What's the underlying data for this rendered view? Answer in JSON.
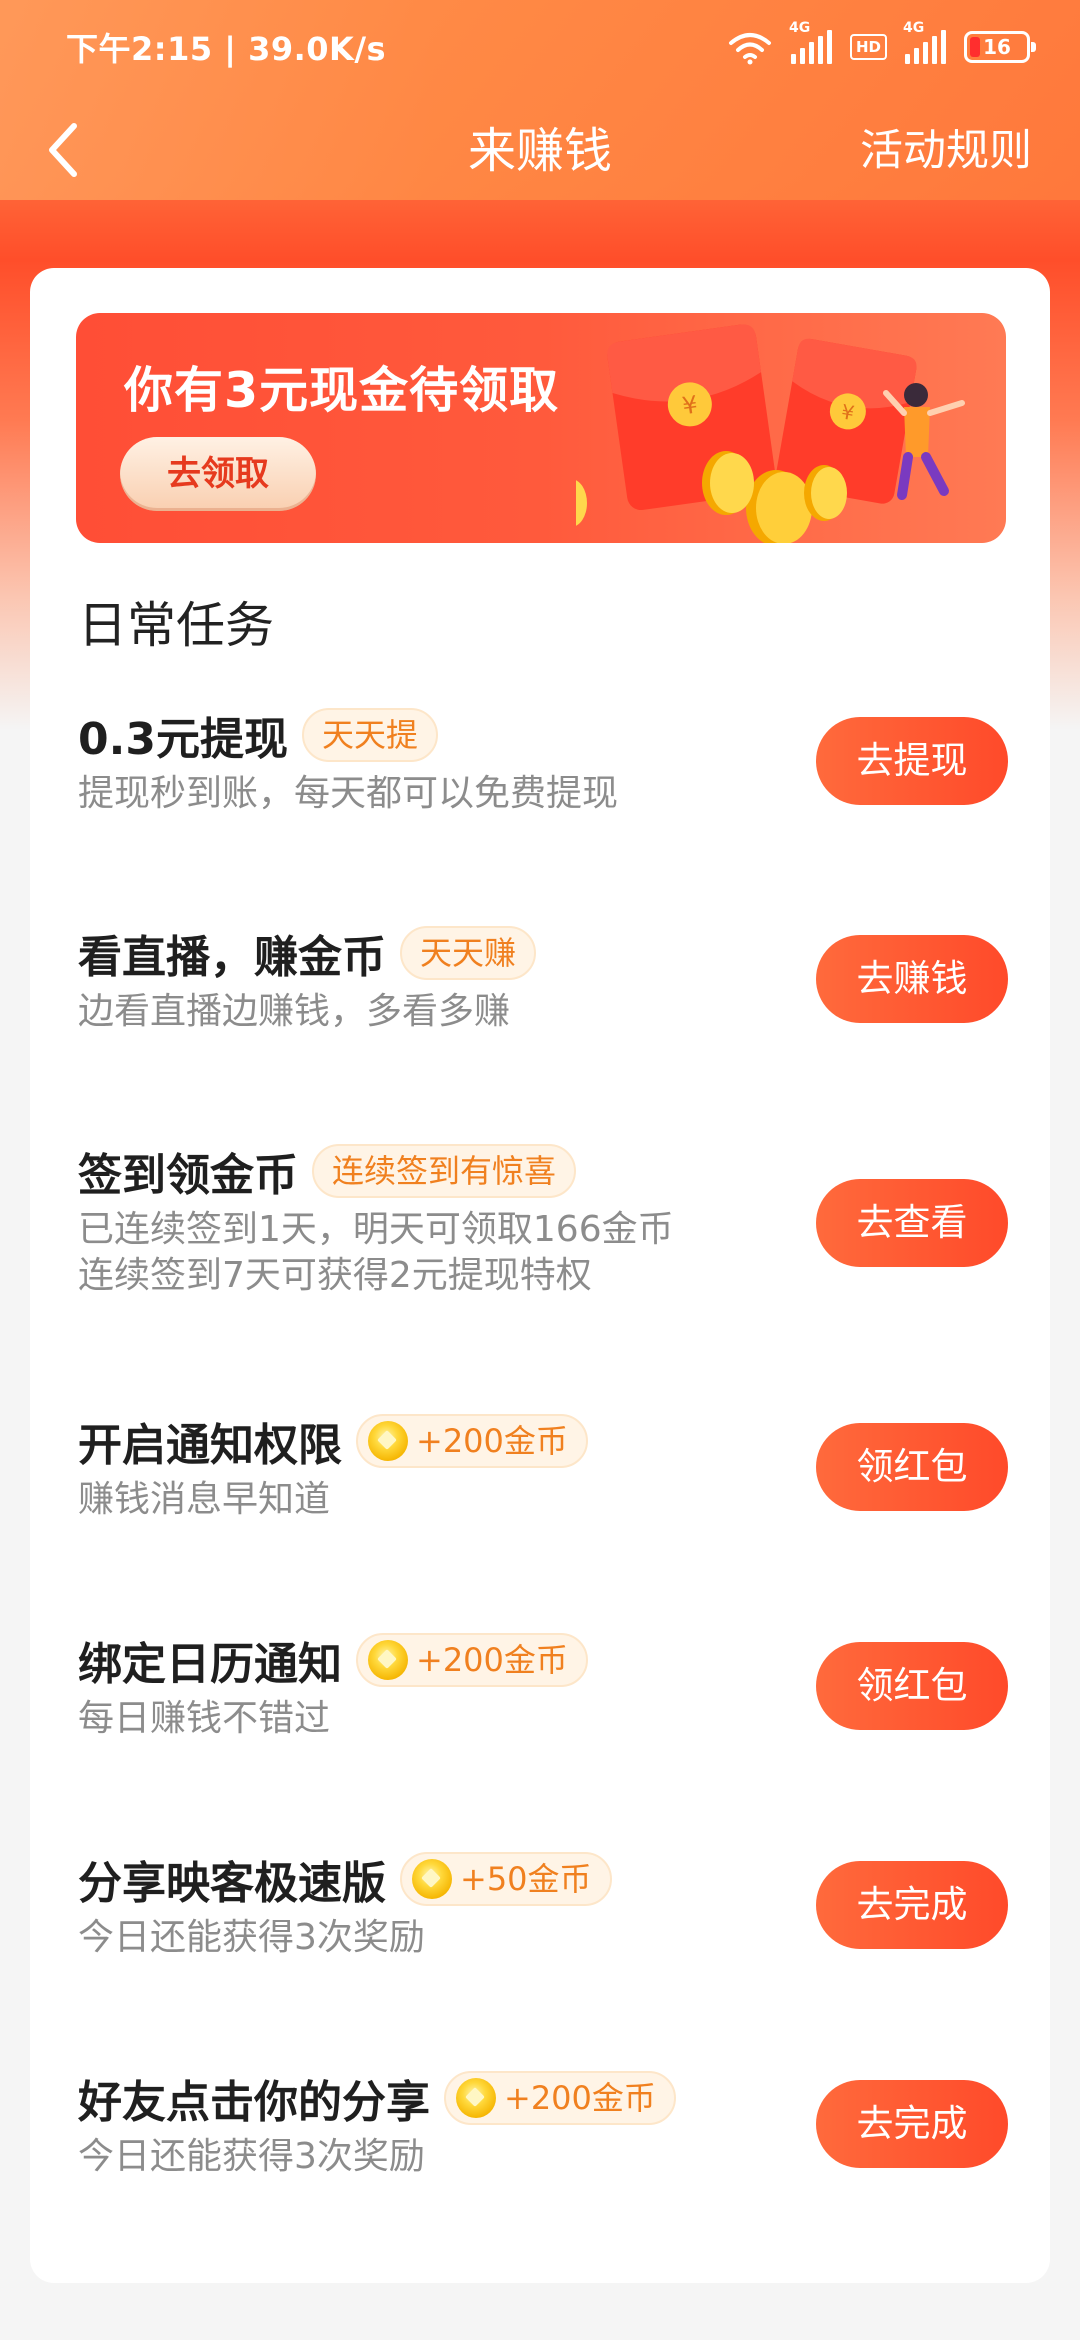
{
  "status_bar": {
    "time": "下午2:15 | 39.0K/s",
    "net1": "4G",
    "hd": "HD",
    "net2": "4G",
    "battery": "16"
  },
  "nav": {
    "title": "来赚钱",
    "rules": "活动规则"
  },
  "banner": {
    "title": "你有3元现金待领取",
    "button": "去领取"
  },
  "section_title": "日常任务",
  "tasks": [
    {
      "title": "0.3元提现",
      "badge": "天天提",
      "desc": "提现秒到账，每天都可以免费提现",
      "button": "去提现"
    },
    {
      "title": "看直播，赚金币",
      "badge": "天天赚",
      "desc": "边看直播边赚钱，多看多赚",
      "button": "去赚钱"
    },
    {
      "title": "签到领金币",
      "badge": "连续签到有惊喜",
      "desc": "已连续签到1天，明天可领取166金币",
      "desc2": "连续签到7天可获得2元提现特权",
      "button": "去查看"
    },
    {
      "title": "开启通知权限",
      "badge": "+200金币",
      "desc": "赚钱消息早知道",
      "button": "领红包"
    },
    {
      "title": "绑定日历通知",
      "badge": "+200金币",
      "desc": "每日赚钱不错过",
      "button": "领红包"
    },
    {
      "title": "分享映客极速版",
      "badge": "+50金币",
      "desc": "今日还能获得3次奖励",
      "button": "去完成"
    },
    {
      "title": "好友点击你的分享",
      "badge": "+200金币",
      "desc": "今日还能获得3次奖励",
      "button": "去完成"
    }
  ],
  "colors": {
    "accent": "#ff5533",
    "badge_text": "#f0801f",
    "badge_bg": "#fff4e6"
  }
}
